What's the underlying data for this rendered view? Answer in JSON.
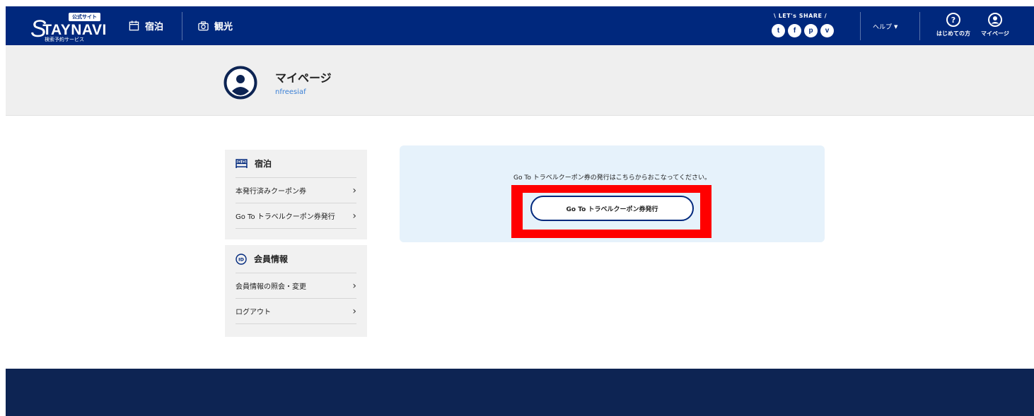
{
  "header": {
    "logo": {
      "badge": "公式サイト",
      "wordmark_initial": "S",
      "wordmark_rest": "TAYNAVI",
      "subtitle": "検索予約サービス"
    },
    "nav": [
      {
        "label": "宿泊",
        "icon": "calendar-icon"
      },
      {
        "label": "観光",
        "icon": "camera-icon"
      }
    ],
    "share": {
      "label": "\\ LET's SHARE /",
      "icons": [
        {
          "name": "twitter-icon",
          "glyph": "t"
        },
        {
          "name": "facebook-icon",
          "glyph": "f"
        },
        {
          "name": "pinterest-icon",
          "glyph": "p"
        },
        {
          "name": "pocket-icon",
          "glyph": "v"
        }
      ]
    },
    "help_label": "ヘルプ",
    "first_time_label": "はじめての方",
    "first_time_glyph": "?",
    "mypage_label": "マイページ"
  },
  "profile": {
    "title": "マイページ",
    "username": "nfreesiaf"
  },
  "sidebar": {
    "sections": [
      {
        "title": "宿泊",
        "icon": "bed-icon",
        "items": [
          {
            "label": "本発行済みクーポン券"
          },
          {
            "label": "Go To トラベルクーポン券発行"
          }
        ]
      },
      {
        "title": "会員情報",
        "icon": "member-icon",
        "icon_text": "ID",
        "items": [
          {
            "label": "会員情報の照会・変更"
          },
          {
            "label": "ログアウト"
          }
        ]
      }
    ],
    "chevron": "›"
  },
  "main": {
    "message": "Go To トラベルクーポン券の発行はこちらからおこなってください。",
    "button_label": "Go To トラベルクーポン券発行"
  },
  "colors": {
    "header_bg": "#00287d",
    "footer_bg": "#0d2453",
    "highlight": "#ff0000",
    "main_box_bg": "#e6f2fb",
    "link_blue": "#3a7fd5"
  }
}
